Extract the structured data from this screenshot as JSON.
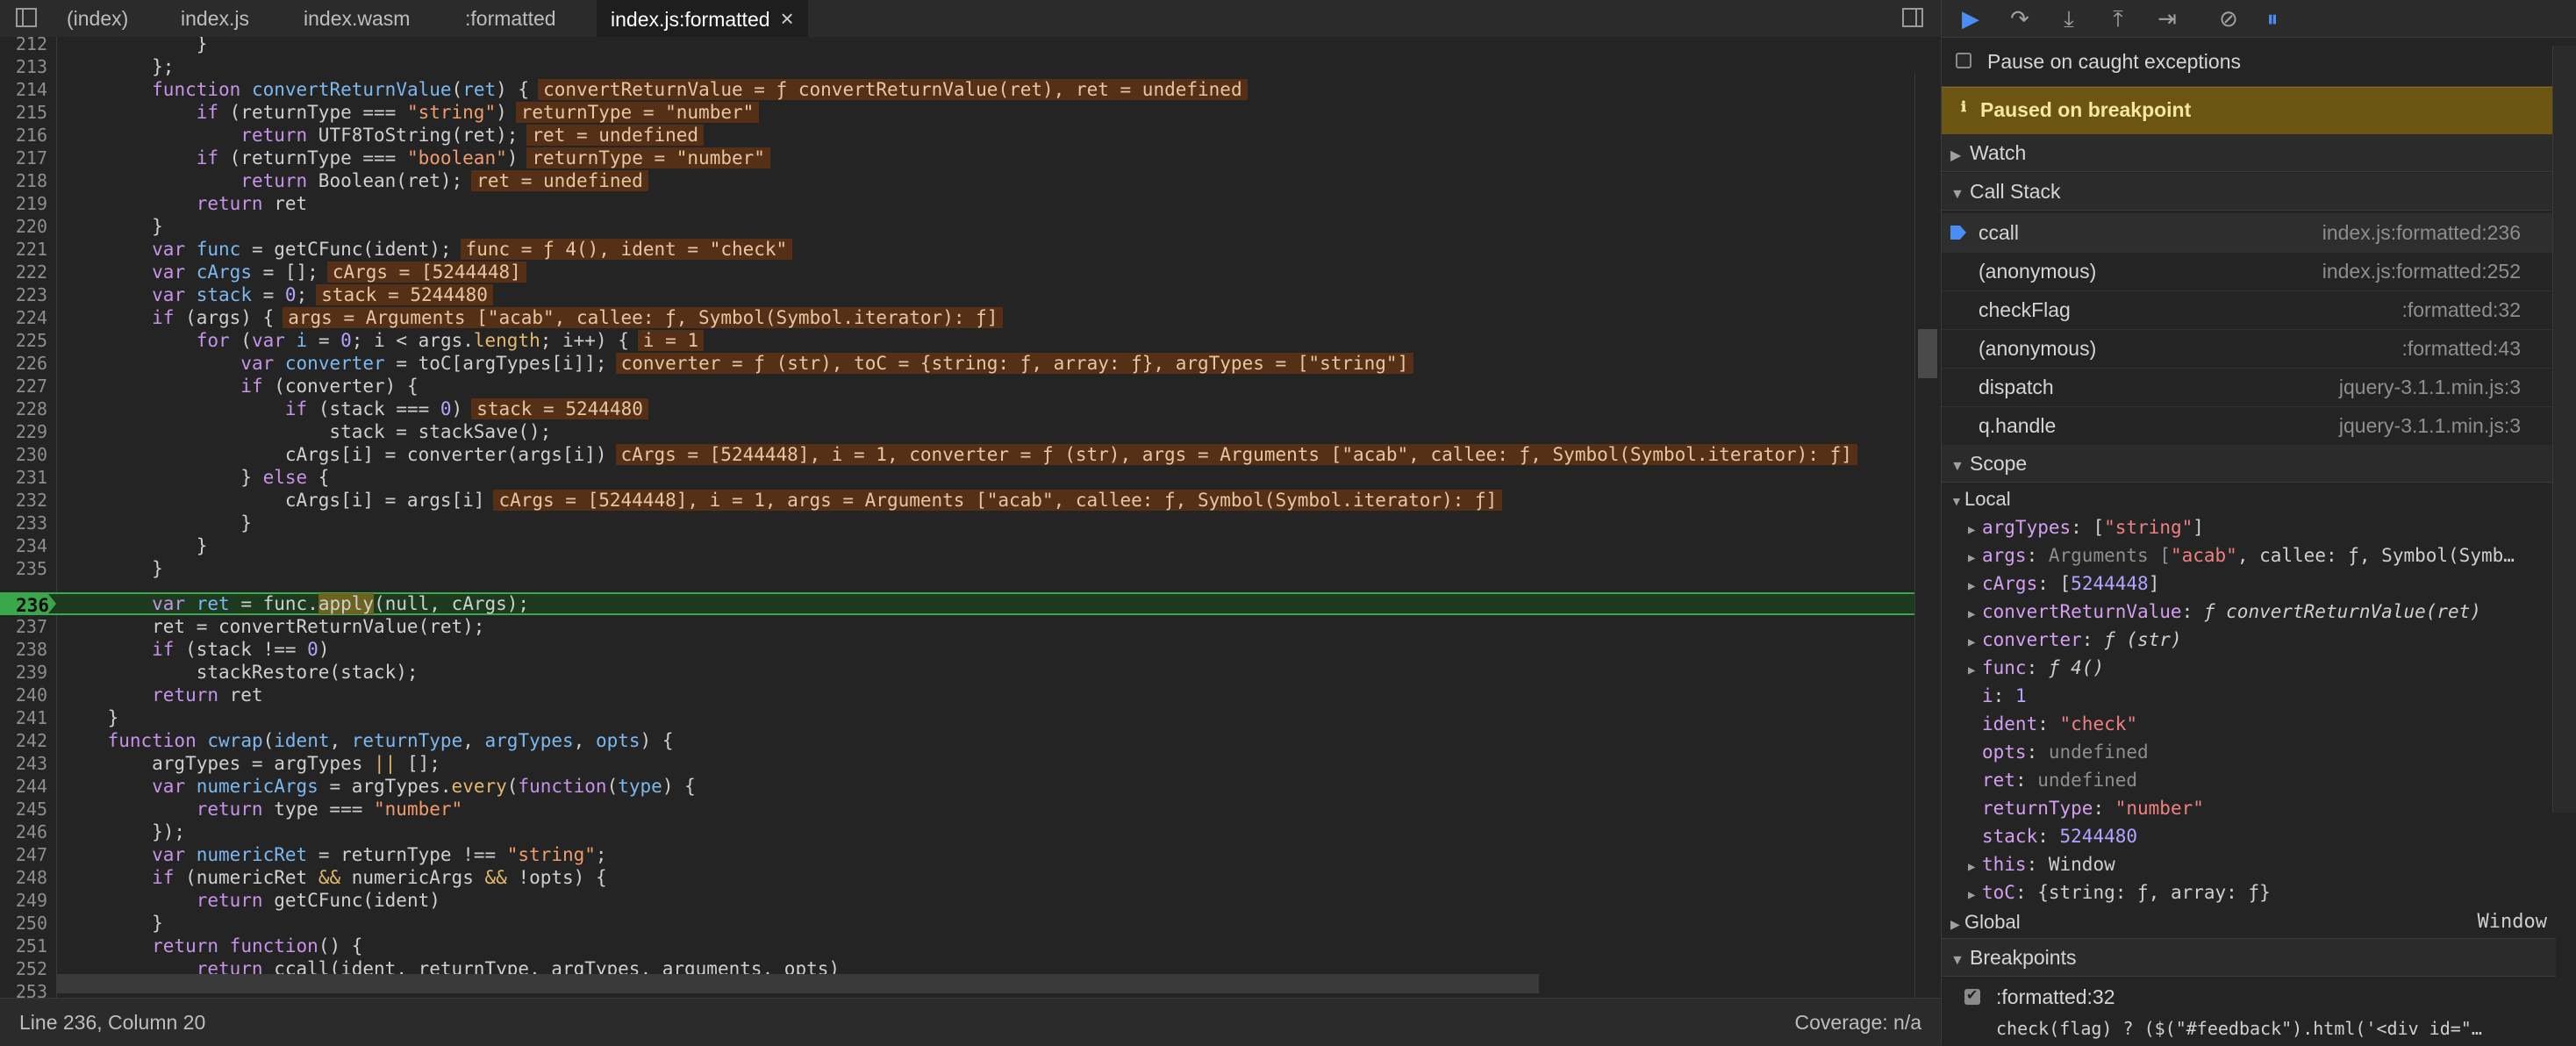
{
  "tabs": [
    {
      "label": "(index)"
    },
    {
      "label": "index.js"
    },
    {
      "label": "index.wasm"
    },
    {
      "label": ":formatted"
    },
    {
      "label": "index.js:formatted",
      "active": true
    }
  ],
  "code_lines": [
    {
      "n": "212"
    },
    {
      "n": "213"
    },
    {
      "n": "214"
    },
    {
      "n": "215"
    },
    {
      "n": "216"
    },
    {
      "n": "217"
    },
    {
      "n": "218"
    },
    {
      "n": "219"
    },
    {
      "n": "220"
    },
    {
      "n": "221"
    },
    {
      "n": "222"
    },
    {
      "n": "223"
    },
    {
      "n": "224"
    },
    {
      "n": "225"
    },
    {
      "n": "226"
    },
    {
      "n": "227"
    },
    {
      "n": "228"
    },
    {
      "n": "229"
    },
    {
      "n": "230"
    },
    {
      "n": "231"
    },
    {
      "n": "232"
    },
    {
      "n": "233"
    },
    {
      "n": "234"
    },
    {
      "n": "235"
    },
    {
      "n": "236"
    },
    {
      "n": "237"
    },
    {
      "n": "238"
    },
    {
      "n": "239"
    },
    {
      "n": "240"
    },
    {
      "n": "241"
    },
    {
      "n": "242"
    },
    {
      "n": "243"
    },
    {
      "n": "244"
    },
    {
      "n": "245"
    },
    {
      "n": "246"
    },
    {
      "n": "247"
    },
    {
      "n": "248"
    },
    {
      "n": "249"
    },
    {
      "n": "250"
    },
    {
      "n": "251"
    },
    {
      "n": "252"
    },
    {
      "n": "253"
    }
  ],
  "code_text": {
    "l212": "            }",
    "l213": "        };",
    "l214a": "        ",
    "l214b": "function",
    "l214c": " ",
    "l214d": "convertReturnValue",
    "l214e": "(",
    "l214f": "ret",
    "l214g": ") {",
    "l214inl": "convertReturnValue = ƒ convertReturnValue(ret), ret = undefined",
    "l215a": "            ",
    "l215b": "if",
    "l215c": " (returnType === ",
    "l215d": "\"string\"",
    "l215e": ")",
    "l215inl": "returnType = \"number\"",
    "l216a": "                ",
    "l216b": "return",
    "l216c": " UTF8ToString(ret);",
    "l216inl": "ret = undefined",
    "l217a": "            ",
    "l217b": "if",
    "l217c": " (returnType === ",
    "l217d": "\"boolean\"",
    "l217e": ")",
    "l217inl": "returnType = \"number\"",
    "l218a": "                ",
    "l218b": "return",
    "l218c": " Boolean(ret);",
    "l218inl": "ret = undefined",
    "l219a": "            ",
    "l219b": "return",
    "l219c": " ret",
    "l220": "        }",
    "l221a": "        ",
    "l221b": "var",
    "l221c": " ",
    "l221d": "func",
    "l221e": " = getCFunc(ident);",
    "l221inl": "func = ƒ 4(), ident = \"check\"",
    "l222a": "        ",
    "l222b": "var",
    "l222c": " ",
    "l222d": "cArgs",
    "l222e": " = [];",
    "l222inl": "cArgs = [5244448]",
    "l223a": "        ",
    "l223b": "var",
    "l223c": " ",
    "l223d": "stack",
    "l223e": " = ",
    "l223f": "0",
    "l223g": ";",
    "l223inl": "stack = 5244480",
    "l224a": "        ",
    "l224b": "if",
    "l224c": " (args) {",
    "l224inl": "args = Arguments [\"acab\", callee: ƒ, Symbol(Symbol.iterator): ƒ]",
    "l225a": "            ",
    "l225b": "for",
    "l225c": " (",
    "l225d": "var",
    "l225e": " ",
    "l225f": "i",
    "l225g": " = ",
    "l225h": "0",
    "l225i": "; i < args.",
    "l225j": "length",
    "l225k": "; i++) {",
    "l225inl": "i = 1",
    "l226a": "                ",
    "l226b": "var",
    "l226c": " ",
    "l226d": "converter",
    "l226e": " = toC[argTypes[i]];",
    "l226inl": "converter = ƒ (str), toC = {string: ƒ, array: ƒ}, argTypes = [\"string\"]",
    "l227a": "                ",
    "l227b": "if",
    "l227c": " (converter) {",
    "l228a": "                    ",
    "l228b": "if",
    "l228c": " (stack === ",
    "l228d": "0",
    "l228e": ")",
    "l228inl": "stack = 5244480",
    "l229": "                        stack = stackSave();",
    "l230": "                    cArgs[i] = converter(args[i])",
    "l230inl": "cArgs = [5244448], i = 1, converter = ƒ (str), args = Arguments [\"acab\", callee: ƒ, Symbol(Symbol.iterator): ƒ]",
    "l231a": "                } ",
    "l231b": "else",
    "l231c": " {",
    "l232": "                    cArgs[i] = args[i]",
    "l232inl": "cArgs = [5244448], i = 1, args = Arguments [\"acab\", callee: ƒ, Symbol(Symbol.iterator): ƒ]",
    "l233": "                }",
    "l234": "            }",
    "l235": "        }",
    "l236a": "        ",
    "l236b": "var",
    "l236c": " ",
    "l236d": "ret",
    "l236e": " = func.",
    "l236f": "apply",
    "l236g": "(null, cArgs);",
    "l237": "        ret = convertReturnValue(ret);",
    "l238a": "        ",
    "l238b": "if",
    "l238c": " (stack !== ",
    "l238d": "0",
    "l238e": ")",
    "l239": "            stackRestore(stack);",
    "l240a": "        ",
    "l240b": "return",
    "l240c": " ret",
    "l241": "    }",
    "l242a": "    ",
    "l242b": "function",
    "l242c": " ",
    "l242d": "cwrap",
    "l242e": "(",
    "l242f": "ident",
    "l242g": ", ",
    "l242h": "returnType",
    "l242i": ", ",
    "l242j": "argTypes",
    "l242k": ", ",
    "l242l": "opts",
    "l242m": ") {",
    "l243a": "        argTypes = argTypes ",
    "l243b": "||",
    "l243c": " [];",
    "l244a": "        ",
    "l244b": "var",
    "l244c": " ",
    "l244d": "numericArgs",
    "l244e": " = argTypes.",
    "l244f": "every",
    "l244g": "(",
    "l244h": "function",
    "l244i": "(",
    "l244j": "type",
    "l244k": ") {",
    "l245a": "            ",
    "l245b": "return",
    "l245c": " type === ",
    "l245d": "\"number\"",
    "l246": "        });",
    "l247a": "        ",
    "l247b": "var",
    "l247c": " ",
    "l247d": "numericRet",
    "l247e": " = returnType !== ",
    "l247f": "\"string\"",
    "l247g": ";",
    "l248a": "        ",
    "l248b": "if",
    "l248c": " (numericRet ",
    "l248d": "&&",
    "l248e": " numericArgs ",
    "l248f": "&&",
    "l248g": " !opts) {",
    "l249a": "            ",
    "l249b": "return",
    "l249c": " getCFunc(ident)",
    "l250": "        }",
    "l251a": "        ",
    "l251b": "return",
    "l251c": " ",
    "l251d": "function",
    "l251e": "() {",
    "l252a": "            ",
    "l252b": "return",
    "l252c": " ccall(ident, returnType, argTypes, arguments, opts)",
    "l253": ""
  },
  "status": {
    "position": "Line 236, Column 20",
    "coverage": "Coverage: n/a"
  },
  "debugger": {
    "pause_on_caught": "Pause on caught exceptions",
    "paused_banner": "Paused on breakpoint",
    "paused_icon": "info-icon",
    "watch": "Watch",
    "call_stack": "Call Stack",
    "call_stack_items": [
      {
        "name": "ccall",
        "loc": "index.js:formatted:236"
      },
      {
        "name": "(anonymous)",
        "loc": "index.js:formatted:252"
      },
      {
        "name": "checkFlag",
        "loc": ":formatted:32"
      },
      {
        "name": "(anonymous)",
        "loc": ":formatted:43"
      },
      {
        "name": "dispatch",
        "loc": "jquery-3.1.1.min.js:3"
      },
      {
        "name": "q.handle",
        "loc": "jquery-3.1.1.min.js:3"
      }
    ],
    "scope": "Scope",
    "local": "Local",
    "scope_vars": [
      {
        "k": "argTypes",
        "v1": "[",
        "v2": "\"string\"",
        "v3": "]"
      },
      {
        "k": "args",
        "v1": "Arguments [",
        "v2": "\"acab\"",
        "v3": ", callee: ƒ, Symbol(Symb…"
      },
      {
        "k": "cArgs",
        "v1": "[",
        "v2": "5244448",
        "v3": "]"
      },
      {
        "k": "convertReturnValue",
        "v1": "ƒ convertReturnValue(ret)"
      },
      {
        "k": "converter",
        "v1": "ƒ (str)"
      },
      {
        "k": "func",
        "v1": "ƒ 4()"
      },
      {
        "k": "i",
        "v1": "1"
      },
      {
        "k": "ident",
        "v1": "\"check\""
      },
      {
        "k": "opts",
        "v1": "undefined"
      },
      {
        "k": "ret",
        "v1": "undefined"
      },
      {
        "k": "returnType",
        "v1": "\"number\""
      },
      {
        "k": "stack",
        "v1": "5244480"
      },
      {
        "k": "this",
        "v1": "Window"
      },
      {
        "k": "toC",
        "v1": "{string: ƒ, array: ƒ}"
      }
    ],
    "global": "Global",
    "global_val": "Window",
    "breakpoints": "Breakpoints",
    "bp_item_label": ":formatted:32",
    "bp_item_code": "check(flag) ? ($(\"#feedback\").html('<div id=\"…"
  }
}
